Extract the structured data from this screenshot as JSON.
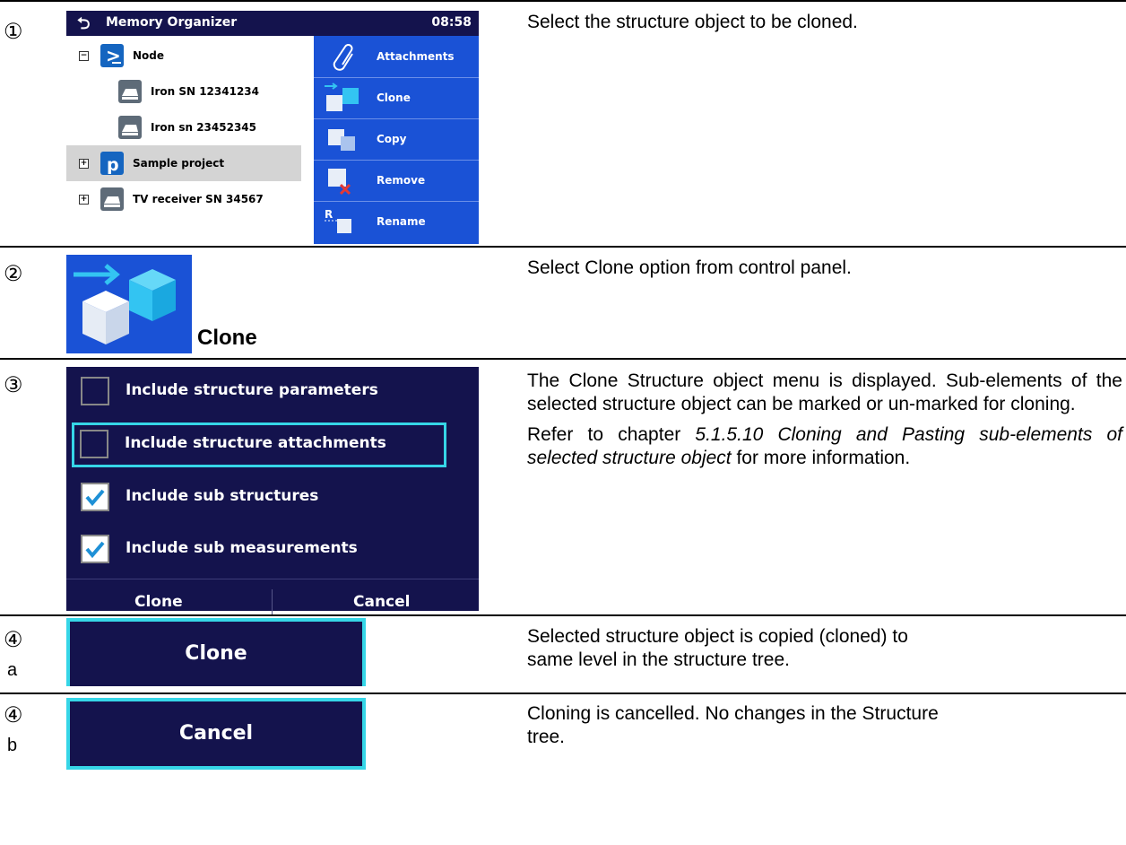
{
  "steps": [
    {
      "marker": "①",
      "sub": "",
      "description": [
        "Select the structure object to be cloned."
      ]
    },
    {
      "marker": "②",
      "sub": "",
      "description": [
        "Select Clone option from control panel."
      ]
    },
    {
      "marker": "③",
      "sub": "",
      "description": []
    },
    {
      "marker": "④",
      "sub": "a",
      "description": [
        "Selected structure object is copied (cloned) to same level in the structure tree."
      ]
    },
    {
      "marker": "④",
      "sub": "b",
      "description": [
        "Cloning is cancelled. No changes in the Structure tree."
      ]
    }
  ],
  "step3_text": {
    "para1": "The Clone Structure object menu is displayed. Sub-elements of the selected structure object can be marked or un-marked for cloning.",
    "para2_prefix": "Refer to chapter ",
    "para2_ref": "5.1.5.10 Cloning and Pasting sub-elements of selected structure object",
    "para2_suffix": " for more information."
  },
  "screen1": {
    "title": "Memory Organizer",
    "time": "08:58",
    "back_icon": "back-arrow-icon",
    "tree": [
      {
        "label": "Node",
        "icon": "node-icon",
        "expander": "−",
        "selected": false
      },
      {
        "label": "Iron SN 12341234",
        "icon": "appliance-icon",
        "expander": "",
        "selected": false
      },
      {
        "label": "Iron sn 23452345",
        "icon": "appliance-icon",
        "expander": "",
        "selected": false
      },
      {
        "label": "Sample project",
        "icon": "project-icon",
        "expander": "+",
        "selected": true
      },
      {
        "label": "TV receiver SN 34567",
        "icon": "appliance-icon",
        "expander": "+",
        "selected": false
      }
    ],
    "control_panel": [
      {
        "label": "Attachments",
        "icon": "paperclip-icon"
      },
      {
        "label": "Clone",
        "icon": "clone-icon"
      },
      {
        "label": "Copy",
        "icon": "copy-icon"
      },
      {
        "label": "Remove",
        "icon": "remove-icon"
      },
      {
        "label": "Rename",
        "icon": "rename-icon"
      }
    ]
  },
  "step2_label": "Clone",
  "clone_dialog": {
    "options": [
      {
        "label": "Include structure parameters",
        "checked": false,
        "focused": false
      },
      {
        "label": "Include structure attachments",
        "checked": false,
        "focused": true
      },
      {
        "label": "Include sub structures",
        "checked": true,
        "focused": false
      },
      {
        "label": "Include sub measurements",
        "checked": true,
        "focused": false
      }
    ],
    "clone_button": "Clone",
    "cancel_button": "Cancel"
  },
  "step4a_button": "Clone",
  "step4b_button": "Cancel",
  "colors": {
    "dark_navy": "#14134d",
    "panel_blue": "#1a52d6",
    "focus_cyan": "#36d6e7"
  }
}
